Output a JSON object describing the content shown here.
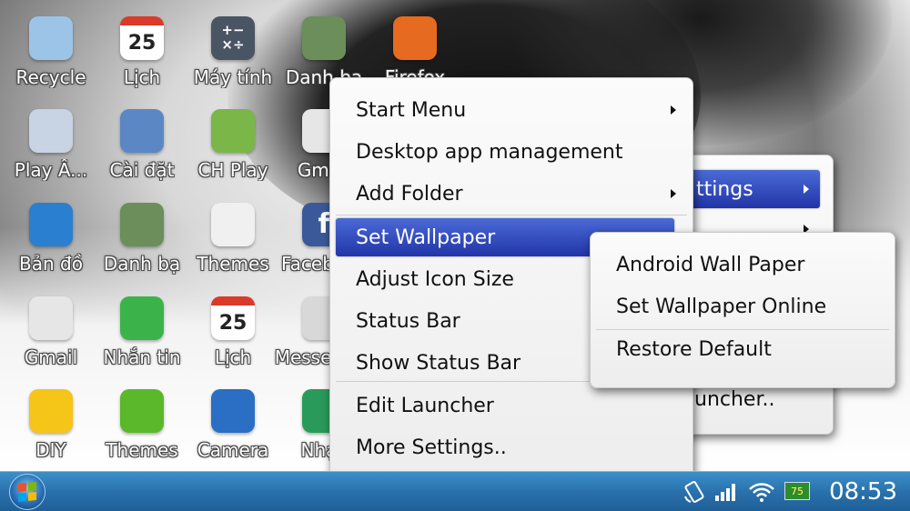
{
  "desktop": {
    "icons": [
      {
        "label": "Recycle",
        "icon": "recycle-bin-icon",
        "color": "#9cc4e6"
      },
      {
        "label": "Lịch",
        "icon": "calendar-icon",
        "color": "#ffffff",
        "badge": "25"
      },
      {
        "label": "Máy tính",
        "icon": "calculator-icon",
        "color": "#4a5563",
        "glyph": "+−\n×÷"
      },
      {
        "label": "Danh bạ",
        "icon": "contacts-icon",
        "color": "#6b8e5a"
      },
      {
        "label": "Firefox",
        "icon": "firefox-icon",
        "color": "#e66a1f"
      },
      {
        "label": "Play Â...",
        "icon": "music-player-icon",
        "color": "#c8d4e4"
      },
      {
        "label": "Cài đặt",
        "icon": "settings-icon",
        "color": "#5b87c4"
      },
      {
        "label": "CH Play",
        "icon": "play-store-icon",
        "color": "#7ab648"
      },
      {
        "label": "Gmail",
        "icon": "gmail-icon",
        "color": "#e6e6e6"
      },
      {
        "label": "Bản đồ",
        "icon": "globe-icon",
        "color": "#2a7fd0"
      },
      {
        "label": "Danh bạ",
        "icon": "contacts-icon",
        "color": "#6b8e5a"
      },
      {
        "label": "Themes",
        "icon": "themes-pinwheel-icon",
        "color": "#f0f0f0"
      },
      {
        "label": "Facebook",
        "icon": "facebook-icon",
        "color": "#3b5998",
        "glyph": "f"
      },
      {
        "label": "Gmail",
        "icon": "mail-envelope-icon",
        "color": "#e6e6e6"
      },
      {
        "label": "Nhắn tin",
        "icon": "messaging-icon",
        "color": "#3cb34a"
      },
      {
        "label": "Lịch",
        "icon": "calendar-icon",
        "color": "#ffffff",
        "badge": "25"
      },
      {
        "label": "Messenger",
        "icon": "messenger-icon",
        "color": "#d8d8d8"
      },
      {
        "label": "DIY",
        "icon": "diy-icon",
        "color": "#f5c518"
      },
      {
        "label": "Themes",
        "icon": "tshirt-icon",
        "color": "#5ab82a"
      },
      {
        "label": "Camera",
        "icon": "camera-icon",
        "color": "#2a6fc4"
      },
      {
        "label": "Nhạc",
        "icon": "music-note-icon",
        "color": "#2a9a5a"
      }
    ]
  },
  "main_menu": {
    "items": [
      {
        "label": "Start Menu",
        "submenu": true
      },
      {
        "label": "Desktop app management",
        "submenu": false
      },
      {
        "label": "Add Folder",
        "submenu": true
      },
      {
        "label": "Set Wallpaper",
        "submenu": true,
        "selected": true
      },
      {
        "label": "Adjust Icon Size",
        "submenu": false
      },
      {
        "label": "Status Bar",
        "submenu": false
      },
      {
        "label": "Show Status Bar",
        "submenu": false
      },
      {
        "label": "Edit Launcher",
        "submenu": false
      },
      {
        "label": "More Settings..",
        "submenu": false
      }
    ]
  },
  "back_menu": {
    "settings_label": "ttings",
    "launcher_label": "uncher.."
  },
  "wallpaper_submenu": {
    "items": [
      {
        "label": "Android Wall Paper"
      },
      {
        "label": "Set Wallpaper Online"
      },
      {
        "label": "Restore Default"
      }
    ]
  },
  "taskbar": {
    "clock": "08:53",
    "battery": "75",
    "start_icon": "windows-start-icon",
    "accent": "#2a72ad"
  }
}
